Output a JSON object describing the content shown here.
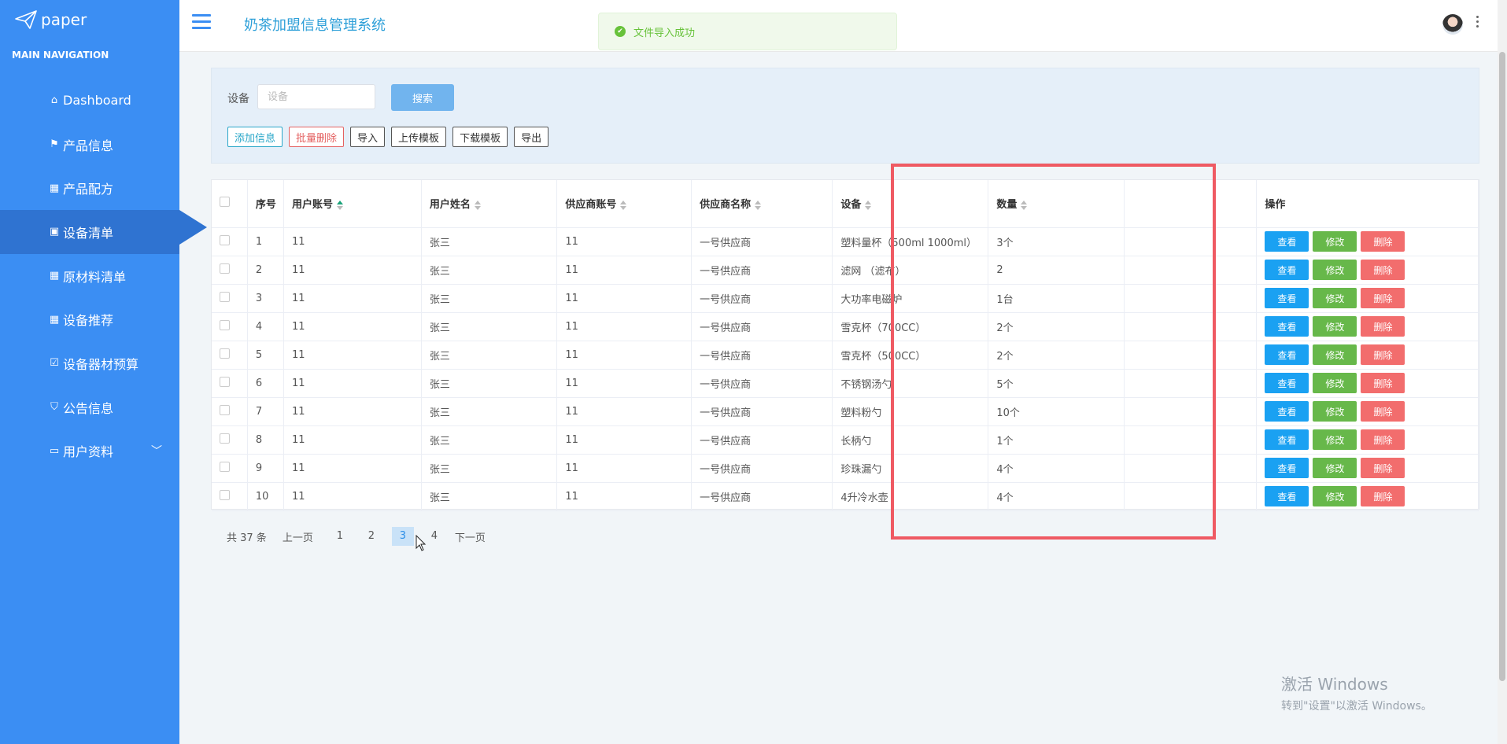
{
  "sidebar": {
    "logo": "paper",
    "nav_header": "MAIN NAVIGATION",
    "items": [
      {
        "label": "Dashboard"
      },
      {
        "label": "产品信息"
      },
      {
        "label": "产品配方"
      },
      {
        "label": "设备清单"
      },
      {
        "label": "原材料清单"
      },
      {
        "label": "设备推荐"
      },
      {
        "label": "设备器材预算"
      },
      {
        "label": "公告信息"
      },
      {
        "label": "用户资料"
      }
    ]
  },
  "header": {
    "title": "奶茶加盟信息管理系统",
    "toast": "文件导入成功"
  },
  "search": {
    "label": "设备",
    "placeholder": "设备",
    "button": "搜索"
  },
  "actions": {
    "add": "添加信息",
    "batch_delete": "批量删除",
    "import": "导入",
    "upload_template": "上传模板",
    "download_template": "下载模板",
    "export": "导出"
  },
  "table": {
    "headers": {
      "index": "序号",
      "account": "用户账号",
      "name": "用户姓名",
      "supplier_account": "供应商账号",
      "supplier_name": "供应商名称",
      "device": "设备",
      "quantity": "数量",
      "ops": "操作"
    },
    "op_labels": {
      "view": "查看",
      "edit": "修改",
      "delete": "删除"
    },
    "rows": [
      {
        "index": "1",
        "account": "11",
        "name": "张三",
        "supplier_account": "11",
        "supplier_name": "一号供应商",
        "device": "塑料量杯（500ml 1000ml）",
        "quantity": "3个"
      },
      {
        "index": "2",
        "account": "11",
        "name": "张三",
        "supplier_account": "11",
        "supplier_name": "一号供应商",
        "device": "滤网 （滤布）",
        "quantity": "2"
      },
      {
        "index": "3",
        "account": "11",
        "name": "张三",
        "supplier_account": "11",
        "supplier_name": "一号供应商",
        "device": "大功率电磁炉",
        "quantity": "1台"
      },
      {
        "index": "4",
        "account": "11",
        "name": "张三",
        "supplier_account": "11",
        "supplier_name": "一号供应商",
        "device": "雪克杯（700CC）",
        "quantity": "2个"
      },
      {
        "index": "5",
        "account": "11",
        "name": "张三",
        "supplier_account": "11",
        "supplier_name": "一号供应商",
        "device": "雪克杯（500CC）",
        "quantity": "2个"
      },
      {
        "index": "6",
        "account": "11",
        "name": "张三",
        "supplier_account": "11",
        "supplier_name": "一号供应商",
        "device": "不锈钢汤勺",
        "quantity": "5个"
      },
      {
        "index": "7",
        "account": "11",
        "name": "张三",
        "supplier_account": "11",
        "supplier_name": "一号供应商",
        "device": "塑料粉勺",
        "quantity": "10个"
      },
      {
        "index": "8",
        "account": "11",
        "name": "张三",
        "supplier_account": "11",
        "supplier_name": "一号供应商",
        "device": "长柄勺",
        "quantity": "1个"
      },
      {
        "index": "9",
        "account": "11",
        "name": "张三",
        "supplier_account": "11",
        "supplier_name": "一号供应商",
        "device": "珍珠漏勺",
        "quantity": "4个"
      },
      {
        "index": "10",
        "account": "11",
        "name": "张三",
        "supplier_account": "11",
        "supplier_name": "一号供应商",
        "device": "4升冷水壶",
        "quantity": "4个"
      }
    ]
  },
  "pagination": {
    "total": "共 37 条",
    "prev": "上一页",
    "pages": [
      "1",
      "2",
      "3",
      "4"
    ],
    "current": "3",
    "next": "下一页"
  },
  "watermark": {
    "line1": "激活 Windows",
    "line2": "转到\"设置\"以激活 Windows。"
  }
}
